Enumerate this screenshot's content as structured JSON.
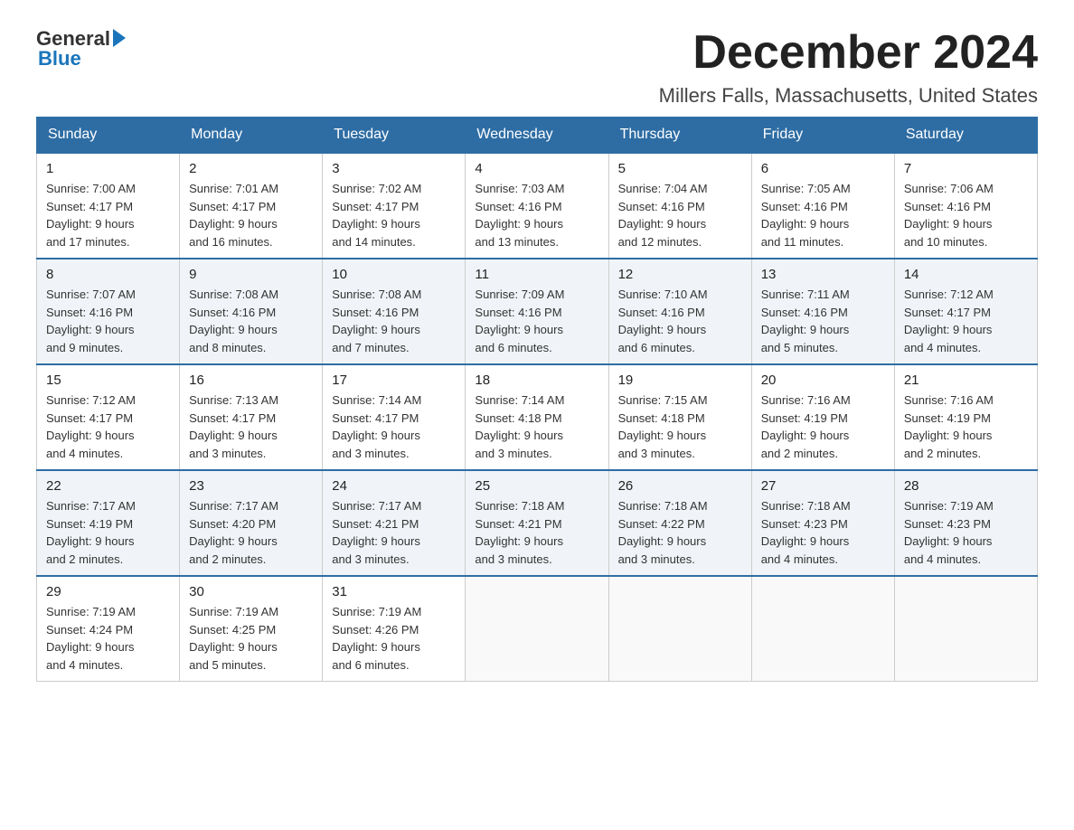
{
  "logo": {
    "general": "General",
    "blue": "Blue"
  },
  "header": {
    "month": "December 2024",
    "location": "Millers Falls, Massachusetts, United States"
  },
  "weekdays": [
    "Sunday",
    "Monday",
    "Tuesday",
    "Wednesday",
    "Thursday",
    "Friday",
    "Saturday"
  ],
  "weeks": [
    [
      {
        "day": "1",
        "sunrise": "7:00 AM",
        "sunset": "4:17 PM",
        "daylight": "9 hours and 17 minutes."
      },
      {
        "day": "2",
        "sunrise": "7:01 AM",
        "sunset": "4:17 PM",
        "daylight": "9 hours and 16 minutes."
      },
      {
        "day": "3",
        "sunrise": "7:02 AM",
        "sunset": "4:17 PM",
        "daylight": "9 hours and 14 minutes."
      },
      {
        "day": "4",
        "sunrise": "7:03 AM",
        "sunset": "4:16 PM",
        "daylight": "9 hours and 13 minutes."
      },
      {
        "day": "5",
        "sunrise": "7:04 AM",
        "sunset": "4:16 PM",
        "daylight": "9 hours and 12 minutes."
      },
      {
        "day": "6",
        "sunrise": "7:05 AM",
        "sunset": "4:16 PM",
        "daylight": "9 hours and 11 minutes."
      },
      {
        "day": "7",
        "sunrise": "7:06 AM",
        "sunset": "4:16 PM",
        "daylight": "9 hours and 10 minutes."
      }
    ],
    [
      {
        "day": "8",
        "sunrise": "7:07 AM",
        "sunset": "4:16 PM",
        "daylight": "9 hours and 9 minutes."
      },
      {
        "day": "9",
        "sunrise": "7:08 AM",
        "sunset": "4:16 PM",
        "daylight": "9 hours and 8 minutes."
      },
      {
        "day": "10",
        "sunrise": "7:08 AM",
        "sunset": "4:16 PM",
        "daylight": "9 hours and 7 minutes."
      },
      {
        "day": "11",
        "sunrise": "7:09 AM",
        "sunset": "4:16 PM",
        "daylight": "9 hours and 6 minutes."
      },
      {
        "day": "12",
        "sunrise": "7:10 AM",
        "sunset": "4:16 PM",
        "daylight": "9 hours and 6 minutes."
      },
      {
        "day": "13",
        "sunrise": "7:11 AM",
        "sunset": "4:16 PM",
        "daylight": "9 hours and 5 minutes."
      },
      {
        "day": "14",
        "sunrise": "7:12 AM",
        "sunset": "4:17 PM",
        "daylight": "9 hours and 4 minutes."
      }
    ],
    [
      {
        "day": "15",
        "sunrise": "7:12 AM",
        "sunset": "4:17 PM",
        "daylight": "9 hours and 4 minutes."
      },
      {
        "day": "16",
        "sunrise": "7:13 AM",
        "sunset": "4:17 PM",
        "daylight": "9 hours and 3 minutes."
      },
      {
        "day": "17",
        "sunrise": "7:14 AM",
        "sunset": "4:17 PM",
        "daylight": "9 hours and 3 minutes."
      },
      {
        "day": "18",
        "sunrise": "7:14 AM",
        "sunset": "4:18 PM",
        "daylight": "9 hours and 3 minutes."
      },
      {
        "day": "19",
        "sunrise": "7:15 AM",
        "sunset": "4:18 PM",
        "daylight": "9 hours and 3 minutes."
      },
      {
        "day": "20",
        "sunrise": "7:16 AM",
        "sunset": "4:19 PM",
        "daylight": "9 hours and 2 minutes."
      },
      {
        "day": "21",
        "sunrise": "7:16 AM",
        "sunset": "4:19 PM",
        "daylight": "9 hours and 2 minutes."
      }
    ],
    [
      {
        "day": "22",
        "sunrise": "7:17 AM",
        "sunset": "4:19 PM",
        "daylight": "9 hours and 2 minutes."
      },
      {
        "day": "23",
        "sunrise": "7:17 AM",
        "sunset": "4:20 PM",
        "daylight": "9 hours and 2 minutes."
      },
      {
        "day": "24",
        "sunrise": "7:17 AM",
        "sunset": "4:21 PM",
        "daylight": "9 hours and 3 minutes."
      },
      {
        "day": "25",
        "sunrise": "7:18 AM",
        "sunset": "4:21 PM",
        "daylight": "9 hours and 3 minutes."
      },
      {
        "day": "26",
        "sunrise": "7:18 AM",
        "sunset": "4:22 PM",
        "daylight": "9 hours and 3 minutes."
      },
      {
        "day": "27",
        "sunrise": "7:18 AM",
        "sunset": "4:23 PM",
        "daylight": "9 hours and 4 minutes."
      },
      {
        "day": "28",
        "sunrise": "7:19 AM",
        "sunset": "4:23 PM",
        "daylight": "9 hours and 4 minutes."
      }
    ],
    [
      {
        "day": "29",
        "sunrise": "7:19 AM",
        "sunset": "4:24 PM",
        "daylight": "9 hours and 4 minutes."
      },
      {
        "day": "30",
        "sunrise": "7:19 AM",
        "sunset": "4:25 PM",
        "daylight": "9 hours and 5 minutes."
      },
      {
        "day": "31",
        "sunrise": "7:19 AM",
        "sunset": "4:26 PM",
        "daylight": "9 hours and 6 minutes."
      },
      null,
      null,
      null,
      null
    ]
  ],
  "labels": {
    "sunrise": "Sunrise:",
    "sunset": "Sunset:",
    "daylight": "Daylight:"
  }
}
